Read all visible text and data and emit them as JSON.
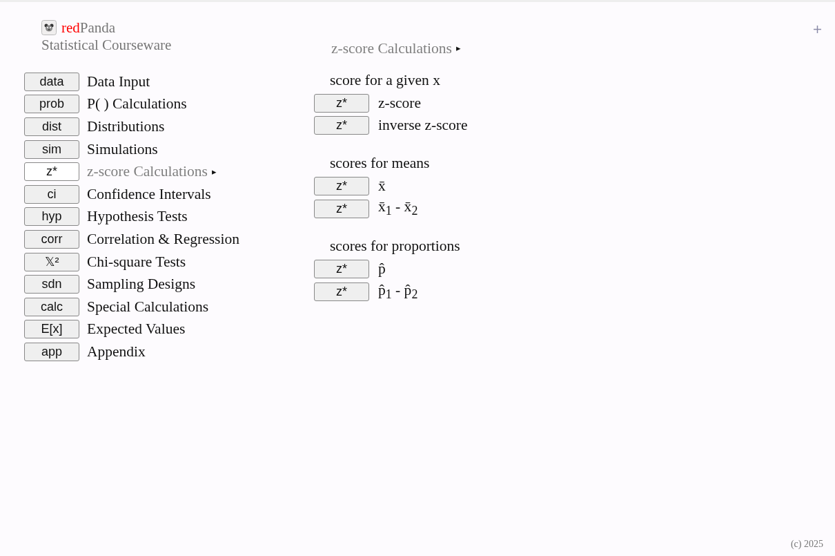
{
  "brand": {
    "prefix": "red",
    "rest": "Panda",
    "subtitle": "Statistical Courseware"
  },
  "menu": [
    {
      "button": "data",
      "label": "Data Input",
      "selected": false
    },
    {
      "button": "prob",
      "label": "P( ) Calculations",
      "selected": false
    },
    {
      "button": "dist",
      "label": "Distributions",
      "selected": false
    },
    {
      "button": "sim",
      "label": "Simulations",
      "selected": false
    },
    {
      "button": "z*",
      "label": "z-score Calculations",
      "selected": true,
      "pointer": "▸"
    },
    {
      "button": "ci",
      "label": "Confidence Intervals",
      "selected": false
    },
    {
      "button": "hyp",
      "label": "Hypothesis Tests",
      "selected": false
    },
    {
      "button": "corr",
      "label": "Correlation & Regression",
      "selected": false
    },
    {
      "button": "𝕏²",
      "label": "Chi-square Tests",
      "selected": false
    },
    {
      "button": "sdn",
      "label": "Sampling Designs",
      "selected": false
    },
    {
      "button": "calc",
      "label": "Special Calculations",
      "selected": false
    },
    {
      "button": "E[x]",
      "label": "Expected Values",
      "selected": false
    },
    {
      "button": "app",
      "label": "Appendix",
      "selected": false
    }
  ],
  "panel": {
    "title": "z-score Calculations",
    "pointer": "▸",
    "sections": [
      {
        "heading": "score for a given x",
        "items": [
          {
            "button": "z*",
            "label": "z-score"
          },
          {
            "button": "z*",
            "label": "inverse z-score"
          }
        ]
      },
      {
        "heading": "scores for means",
        "items": [
          {
            "button": "z*",
            "label": "x̄"
          },
          {
            "button": "z*",
            "label": "x̄$_{1}$ - x̄$_{2}$"
          }
        ]
      },
      {
        "heading": "scores for proportions",
        "items": [
          {
            "button": "z*",
            "label": "p̂"
          },
          {
            "button": "z*",
            "label": "p̂$_{1}$ - p̂$_{2}$"
          }
        ]
      }
    ]
  },
  "footer": "(c) 2025"
}
